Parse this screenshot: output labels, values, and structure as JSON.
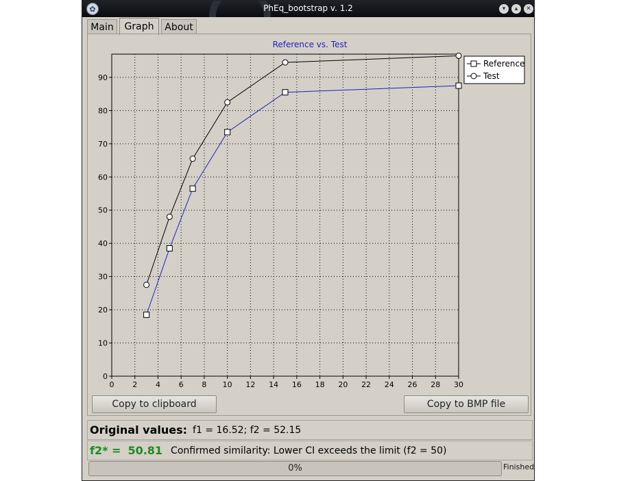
{
  "window": {
    "title": "PhEq_bootstrap v. 1.2"
  },
  "tabs": [
    {
      "label": "Main"
    },
    {
      "label": "Graph"
    },
    {
      "label": "About"
    }
  ],
  "active_tab": "Graph",
  "chart_data": {
    "type": "line",
    "title": "Reference vs. Test",
    "xlabel": "",
    "ylabel": "",
    "xlim": [
      0,
      30
    ],
    "ylim": [
      0,
      97
    ],
    "xticks": [
      0,
      2,
      4,
      6,
      8,
      10,
      12,
      14,
      16,
      18,
      20,
      22,
      24,
      26,
      28,
      30
    ],
    "yticks": [
      0,
      10,
      20,
      30,
      40,
      50,
      60,
      70,
      80,
      90
    ],
    "grid": true,
    "legend_position": "top-right",
    "x": [
      3,
      5,
      7,
      10,
      15,
      30
    ],
    "series": [
      {
        "name": "Reference",
        "marker": "square",
        "color": "#2020c0",
        "values": [
          18.5,
          38.5,
          56.5,
          73.5,
          85.5,
          87.5
        ]
      },
      {
        "name": "Test",
        "marker": "circle",
        "color": "#000000",
        "values": [
          27.5,
          48,
          65.5,
          82.5,
          94.5,
          96.5
        ]
      }
    ]
  },
  "buttons": {
    "copy_clipboard": "Copy to clipboard",
    "copy_bmp": "Copy to BMP file"
  },
  "original": {
    "label": "Original values:",
    "values_text": "f1 =  16.52;   f2 =  52.15"
  },
  "bootstrap": {
    "label": "f2* =",
    "value": "50.81",
    "message": "Confirmed similarity: Lower CI exceeds the limit (f2 = 50)"
  },
  "progress": {
    "value": 0,
    "label": "0%"
  },
  "status": "Finished",
  "colors": {
    "window_bg": "#d4d0c8",
    "chart_title": "#2020c0",
    "accent_green": "#1e8a1e"
  }
}
